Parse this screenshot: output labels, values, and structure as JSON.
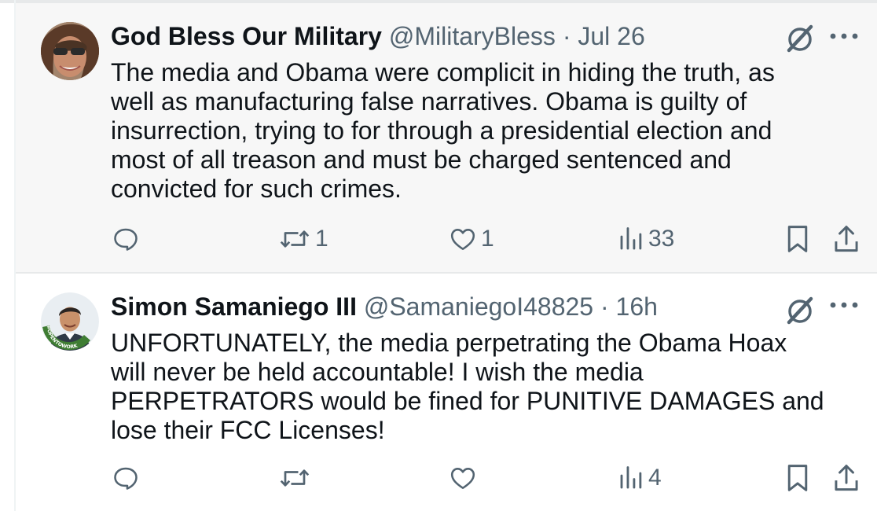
{
  "tweets": [
    {
      "display_name": "God Bless Our Military",
      "handle": "@MilitaryBless",
      "separator": "·",
      "timestamp": "Jul 26",
      "text": "The media and Obama were complicit in hiding the truth, as\nwell as manufacturing false narratives. Obama is guilty of\ninsurrection, trying to for through a presidential election and\nmost of all treason and must be charged sentenced and\nconvicted for such crimes.",
      "reply_count": "",
      "retweet_count": "1",
      "like_count": "1",
      "view_count": "33",
      "avatar_icon": "woman-sunglasses-avatar"
    },
    {
      "display_name": "Simon Samaniego III",
      "handle": "@SamaniegoI48825",
      "separator": "·",
      "timestamp": "16h",
      "text": "UNFORTUNATELY, the media perpetrating the Obama Hoax\nwill never be held accountable! I wish the media\nPERPETRATORS would be fined for PUNITIVE DAMAGES and\nlose their FCC Licenses!",
      "reply_count": "",
      "retweet_count": "",
      "like_count": "",
      "view_count": "4",
      "avatar_icon": "man-opentowork-avatar",
      "avatar_badge_text": "#OPENTOWORK"
    }
  ],
  "icons": {
    "grok": "grok-icon",
    "more": "more-icon",
    "reply": "reply-icon",
    "retweet": "retweet-icon",
    "like": "heart-icon",
    "views": "views-icon",
    "bookmark": "bookmark-icon",
    "share": "share-icon"
  },
  "colors": {
    "text_primary": "#0f1419",
    "text_secondary": "#536471",
    "highlight_background": "#f7f7f7",
    "divider": "#e7e9ea"
  }
}
